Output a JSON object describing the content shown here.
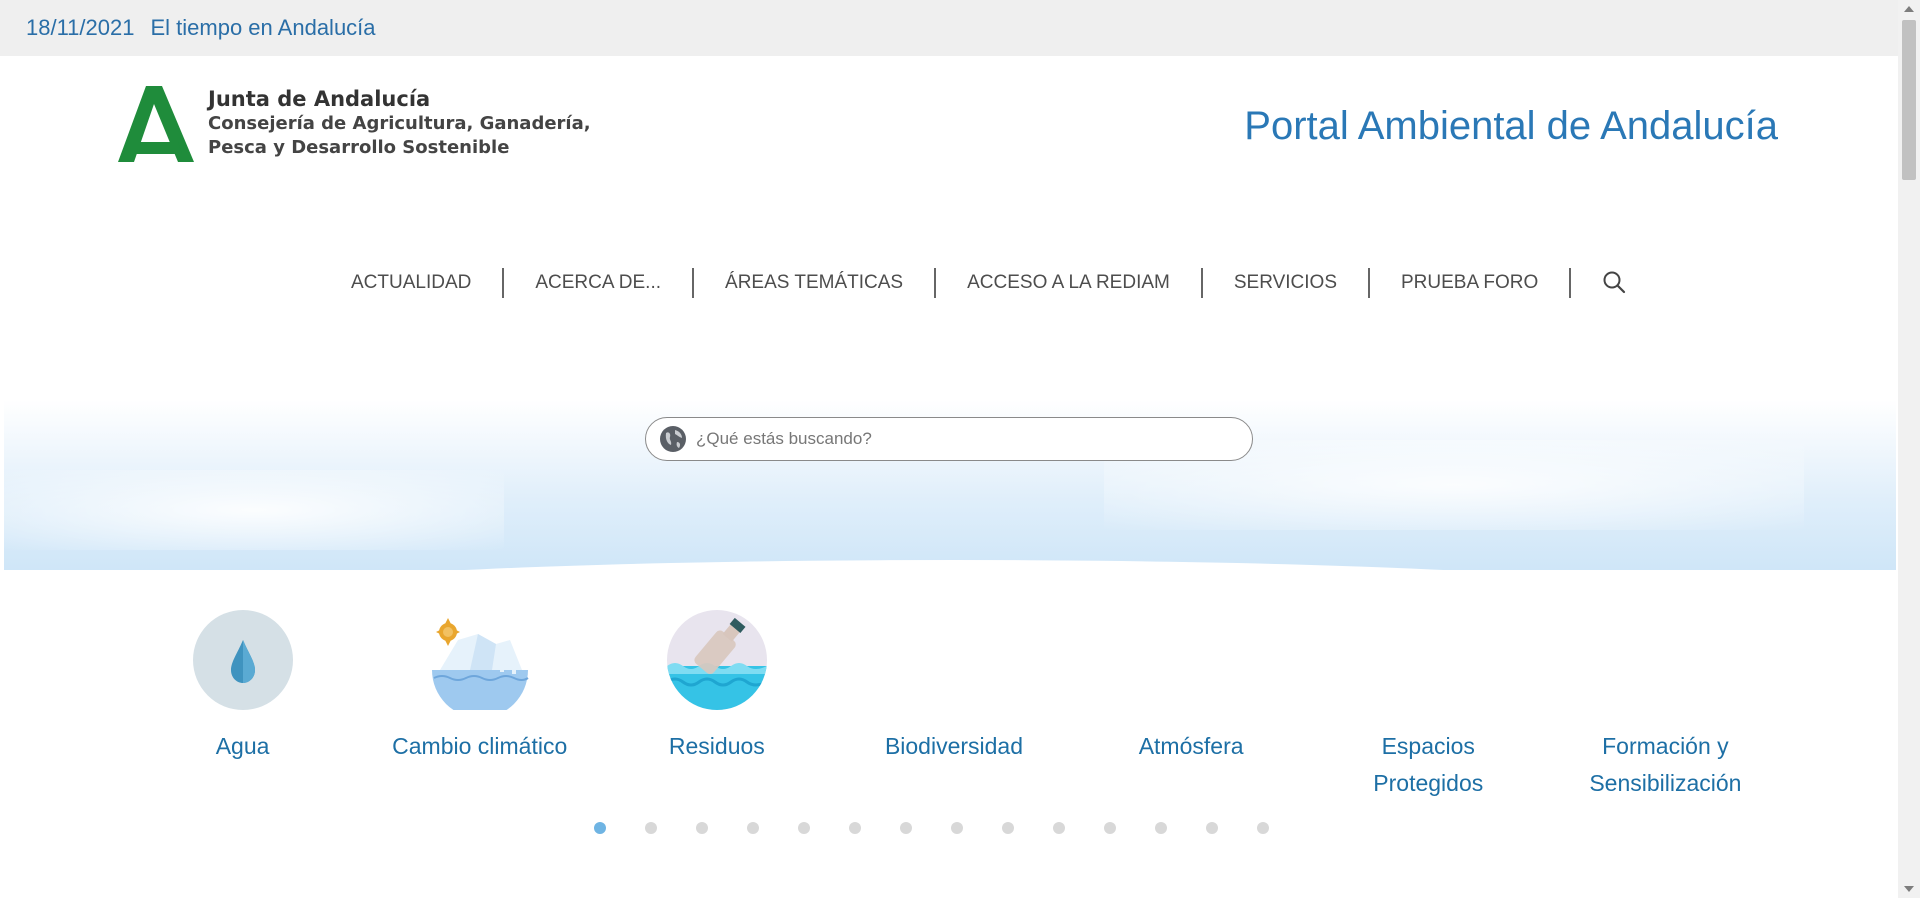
{
  "topbar": {
    "date": "18/11/2021",
    "weather_link": "El tiempo en Andalucía"
  },
  "logo": {
    "line1": "Junta de Andalucía",
    "line2": "Consejería de Agricultura, Ganadería,",
    "line3": "Pesca y Desarrollo Sostenible"
  },
  "portal_title": "Portal Ambiental de Andalucía",
  "nav": {
    "items": [
      "ACTUALIDAD",
      "ACERCA DE...",
      "ÁREAS TEMÁTICAS",
      "ACCESO A LA REDIAM",
      "SERVICIOS",
      "PRUEBA FORO"
    ],
    "search_icon": "search-icon"
  },
  "search": {
    "placeholder": "¿Qué estás buscando?",
    "icon": "globe-icon"
  },
  "topics": [
    {
      "label": "Agua",
      "icon": "water-drop-icon"
    },
    {
      "label": "Cambio climático",
      "icon": "melting-iceberg-icon"
    },
    {
      "label": "Residuos",
      "icon": "bottle-in-sea-icon"
    },
    {
      "label": "Biodiversidad"
    },
    {
      "label": "Atmósfera"
    },
    {
      "label": "Espacios Protegidos"
    },
    {
      "label": "Formación y Sensibilización"
    }
  ],
  "carousel": {
    "total_pages": 14,
    "active_index": 0
  },
  "colors": {
    "link": "#1d6fa5",
    "brand_green": "#1f8c3b",
    "title_blue": "#2a78b6"
  }
}
